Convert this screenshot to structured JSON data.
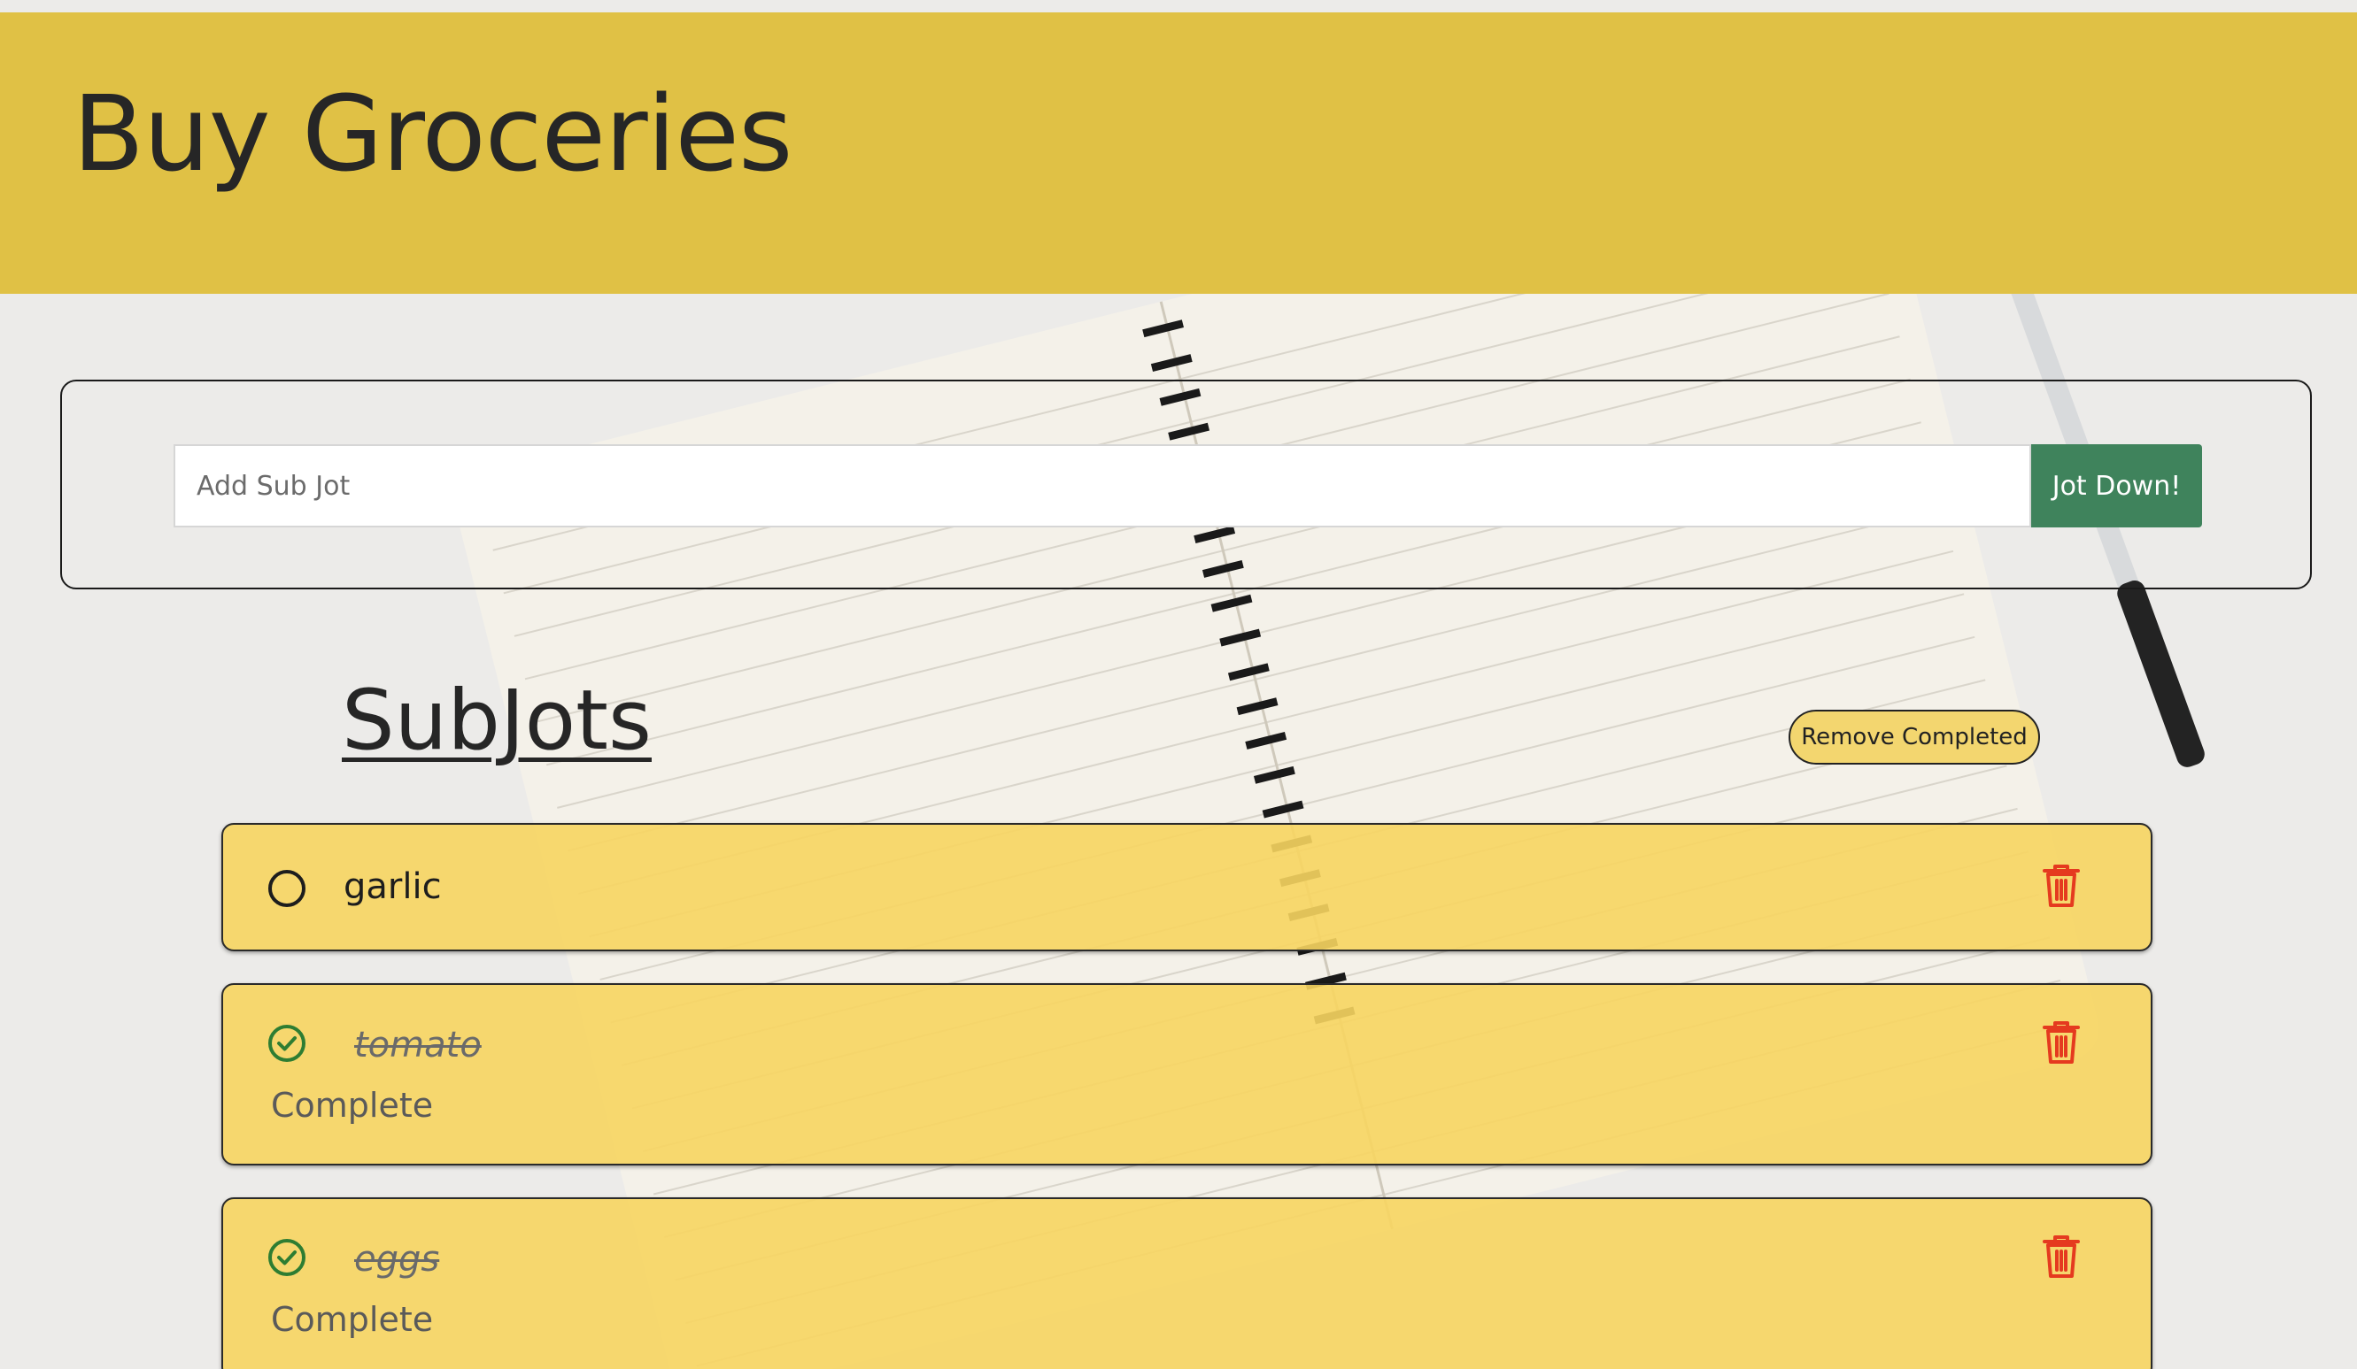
{
  "header": {
    "title": "Buy Groceries"
  },
  "add_form": {
    "placeholder": "Add Sub Jot",
    "value": "",
    "submit_label": "Jot Down!"
  },
  "subjots": {
    "heading": "SubJots",
    "remove_completed_label": "Remove Completed",
    "items": [
      {
        "label": "garlic",
        "completed": false,
        "status": ""
      },
      {
        "label": "tomato",
        "completed": true,
        "status": "Complete"
      },
      {
        "label": "eggs",
        "completed": true,
        "status": "Complete"
      }
    ]
  },
  "colors": {
    "header_bg": "#e0c145",
    "card_bg": "#f7d560",
    "submit_bg": "#3f835c",
    "check_green": "#2e7d32",
    "trash_red": "#e53a1f"
  },
  "icons": {
    "unchecked": "circle-outline-icon",
    "checked": "check-circle-icon",
    "delete": "trash-icon"
  }
}
